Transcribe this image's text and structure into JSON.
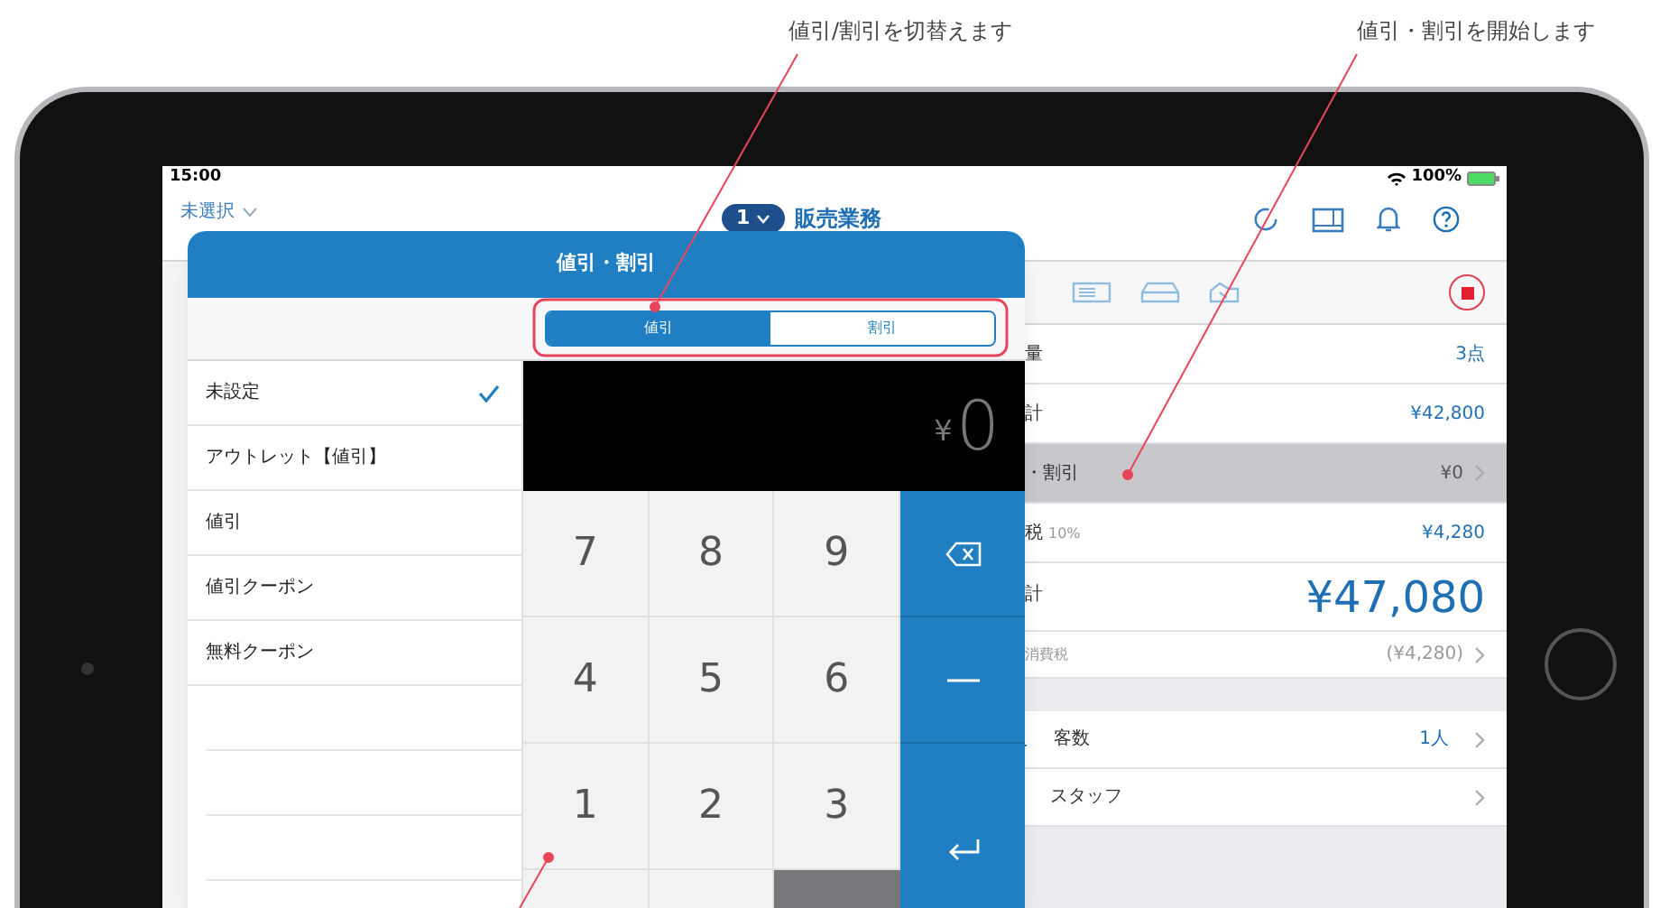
{
  "annotations": [
    {
      "text": "値引/割引を切替えます"
    },
    {
      "text": "値引・割引を開始します"
    }
  ],
  "status_bar": {
    "time": "15:00",
    "battery": "100%"
  },
  "nav_bar": {
    "left": "未選択",
    "badge": "1",
    "title": "販売業務"
  },
  "summary_rows": [
    {
      "label": "量",
      "value": "3点",
      "kind": "normal",
      "selected": false
    },
    {
      "label": "計",
      "value": "¥42,800",
      "kind": "normal",
      "selected": false
    },
    {
      "label": "・割引",
      "value": "¥0",
      "kind": "chevron",
      "selected": true
    },
    {
      "label": "税",
      "note": "10%",
      "value": "¥4,280",
      "kind": "normal",
      "selected": false
    },
    {
      "label": "計",
      "value": "¥47,080",
      "kind": "total",
      "selected": false
    },
    {
      "label": "消費税",
      "value": "(¥4,280)",
      "kind": "sub",
      "selected": false
    }
  ],
  "detail_rows": [
    {
      "label": "客数",
      "value": "1人"
    },
    {
      "label": "スタッフ"
    }
  ],
  "modal": {
    "title": "値引・割引",
    "segments": [
      {
        "label": "値引",
        "selected": true
      },
      {
        "label": "割引",
        "selected": false
      }
    ],
    "discount_types": [
      {
        "label": "未設定",
        "selected": true
      },
      {
        "label": "アウトレット【値引】",
        "selected": false
      },
      {
        "label": "値引",
        "selected": false
      },
      {
        "label": "値引クーポン",
        "selected": false
      },
      {
        "label": "無料クーポン",
        "selected": false
      }
    ],
    "display": {
      "currency": "¥",
      "amount": "0"
    },
    "keys": [
      "7",
      "8",
      "9",
      "4",
      "5",
      "6",
      "1",
      "2",
      "3"
    ]
  }
}
